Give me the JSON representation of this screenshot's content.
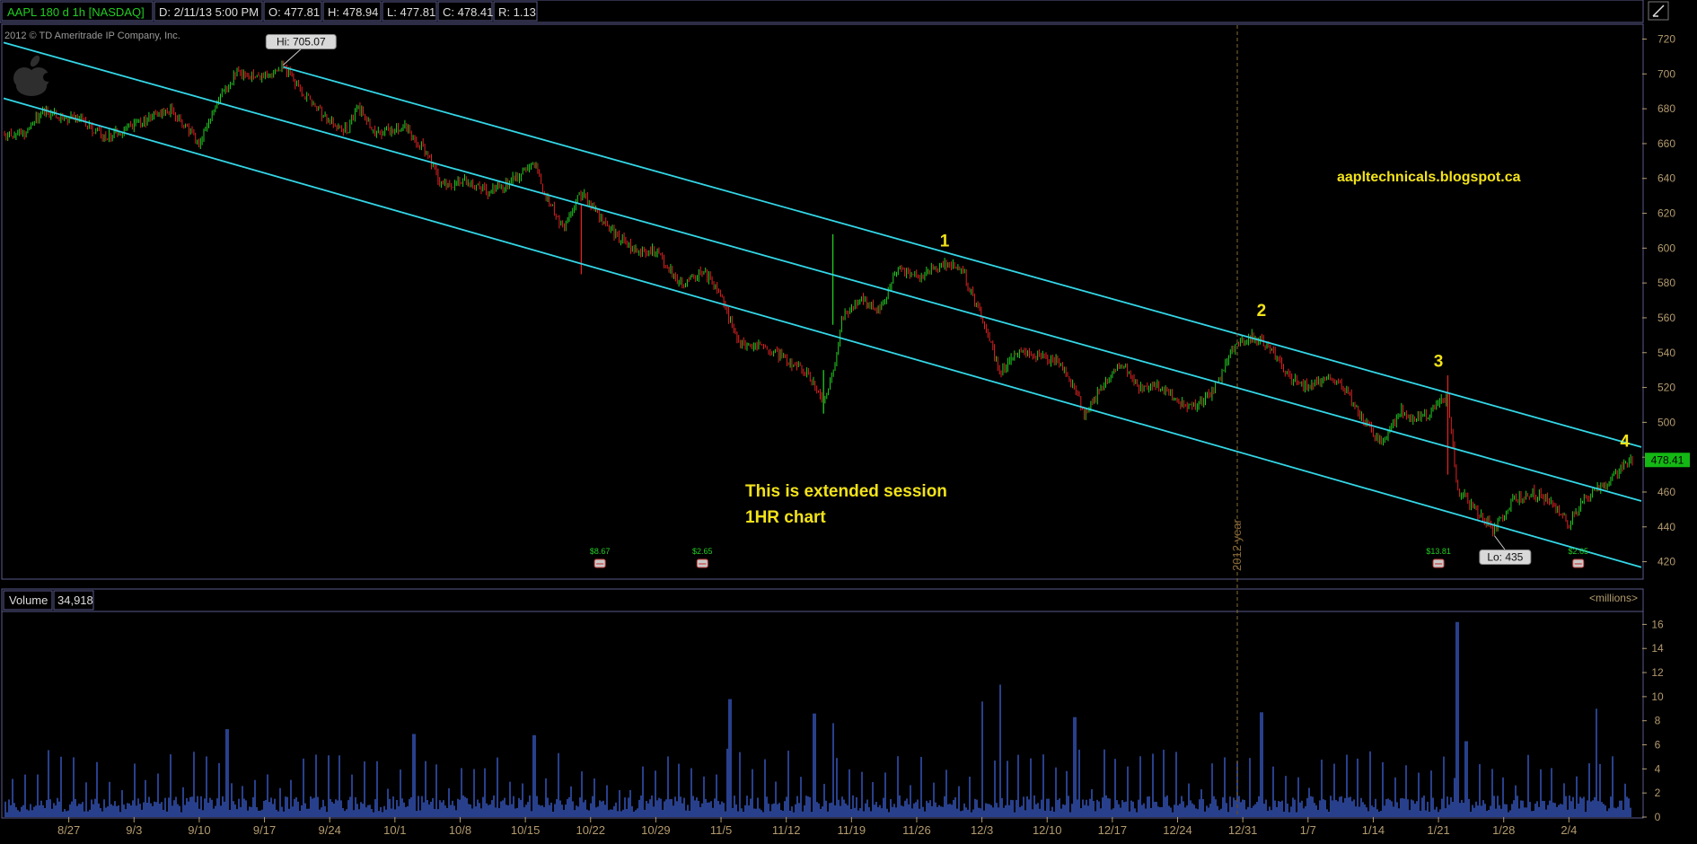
{
  "header": {
    "symbol": "AAPL 180 d 1h [NASDAQ]",
    "date": "D: 2/11/13 5:00 PM",
    "open": "O: 477.81",
    "high": "H: 478.94",
    "low": "L: 477.81",
    "close": "C: 478.41",
    "range": "R: 1.13"
  },
  "copyright": "2012 © TD Ameritrade IP Company, Inc.",
  "watermark_url": "aapltechnicals.blogspot.ca",
  "note_lines": [
    "This is extended session",
    "1HR chart"
  ],
  "year_marker": "2012 year",
  "volume_panel": {
    "label": "Volume",
    "value": "34,918",
    "units": "<millions>"
  },
  "colors": {
    "up": "#22cc22",
    "down": "#dd2222",
    "channel": "#33d6e6",
    "volume": "#3a5cc8",
    "text_yellow": "#f2e21a",
    "axis": "#b39a6e",
    "frame": "#5a5a8c",
    "last_price_bg": "#14b814"
  },
  "chart_data": [
    {
      "type": "candlestick",
      "title": "AAPL 180 d 1h [NASDAQ]",
      "x": [
        "8/27",
        "9/3",
        "9/10",
        "9/17",
        "9/24",
        "10/1",
        "10/8",
        "10/15",
        "10/22",
        "10/29",
        "11/5",
        "11/12",
        "11/19",
        "11/26",
        "12/3",
        "12/10",
        "12/17",
        "12/24",
        "12/31",
        "1/7",
        "1/14",
        "1/21",
        "1/28",
        "2/4"
      ],
      "ylim": [
        410,
        728
      ],
      "y_ticks": [
        420,
        440,
        460,
        480,
        500,
        520,
        540,
        560,
        580,
        600,
        620,
        640,
        660,
        680,
        700,
        720
      ],
      "path_points": [
        {
          "x": "8/22",
          "y": 665
        },
        {
          "x": "8/24",
          "y": 678
        },
        {
          "x": "8/28",
          "y": 674
        },
        {
          "x": "8/31",
          "y": 663
        },
        {
          "x": "9/5",
          "y": 675
        },
        {
          "x": "9/7",
          "y": 680
        },
        {
          "x": "9/10",
          "y": 660
        },
        {
          "x": "9/12",
          "y": 685
        },
        {
          "x": "9/14",
          "y": 700
        },
        {
          "x": "9/17",
          "y": 698
        },
        {
          "x": "9/19",
          "y": 705
        },
        {
          "x": "9/21",
          "y": 690
        },
        {
          "x": "9/24",
          "y": 672
        },
        {
          "x": "9/26",
          "y": 668
        },
        {
          "x": "9/27",
          "y": 682
        },
        {
          "x": "9/29",
          "y": 665
        },
        {
          "x": "10/2",
          "y": 670
        },
        {
          "x": "10/4",
          "y": 658
        },
        {
          "x": "10/6",
          "y": 636
        },
        {
          "x": "10/9",
          "y": 638
        },
        {
          "x": "10/11",
          "y": 632
        },
        {
          "x": "10/14",
          "y": 640
        },
        {
          "x": "10/16",
          "y": 650
        },
        {
          "x": "10/17",
          "y": 632
        },
        {
          "x": "10/19",
          "y": 612
        },
        {
          "x": "10/21",
          "y": 632
        },
        {
          "x": "10/23",
          "y": 618
        },
        {
          "x": "10/25",
          "y": 606
        },
        {
          "x": "10/27",
          "y": 598
        },
        {
          "x": "10/29",
          "y": 598
        },
        {
          "x": "11/1",
          "y": 578
        },
        {
          "x": "11/3",
          "y": 588
        },
        {
          "x": "11/5",
          "y": 572
        },
        {
          "x": "11/7",
          "y": 545
        },
        {
          "x": "11/10",
          "y": 542
        },
        {
          "x": "11/12",
          "y": 536
        },
        {
          "x": "11/14",
          "y": 530
        },
        {
          "x": "11/16",
          "y": 512
        },
        {
          "x": "11/17",
          "y": 528
        },
        {
          "x": "11/18",
          "y": 560
        },
        {
          "x": "11/20",
          "y": 570
        },
        {
          "x": "11/22",
          "y": 565
        },
        {
          "x": "11/24",
          "y": 588
        },
        {
          "x": "11/26",
          "y": 583
        },
        {
          "x": "11/28",
          "y": 588
        },
        {
          "x": "11/29",
          "y": 592
        },
        {
          "x": "12/1",
          "y": 585
        },
        {
          "x": "12/3",
          "y": 560
        },
        {
          "x": "12/5",
          "y": 528
        },
        {
          "x": "12/7",
          "y": 542
        },
        {
          "x": "12/9",
          "y": 538
        },
        {
          "x": "12/11",
          "y": 535
        },
        {
          "x": "12/13",
          "y": 520
        },
        {
          "x": "12/14",
          "y": 503
        },
        {
          "x": "12/16",
          "y": 522
        },
        {
          "x": "12/18",
          "y": 533
        },
        {
          "x": "12/20",
          "y": 520
        },
        {
          "x": "12/22",
          "y": 520
        },
        {
          "x": "12/24",
          "y": 512
        },
        {
          "x": "12/26",
          "y": 508
        },
        {
          "x": "12/28",
          "y": 520
        },
        {
          "x": "12/30",
          "y": 542
        },
        {
          "x": "1/1",
          "y": 550
        },
        {
          "x": "1/3",
          "y": 542
        },
        {
          "x": "1/5",
          "y": 525
        },
        {
          "x": "1/7",
          "y": 520
        },
        {
          "x": "1/9",
          "y": 525
        },
        {
          "x": "1/11",
          "y": 520
        },
        {
          "x": "1/13",
          "y": 500
        },
        {
          "x": "1/15",
          "y": 488
        },
        {
          "x": "1/17",
          "y": 508
        },
        {
          "x": "1/18",
          "y": 502
        },
        {
          "x": "1/20",
          "y": 505
        },
        {
          "x": "1/22",
          "y": 515
        },
        {
          "x": "1/23",
          "y": 462
        },
        {
          "x": "1/25",
          "y": 450
        },
        {
          "x": "1/27",
          "y": 438
        },
        {
          "x": "1/29",
          "y": 455
        },
        {
          "x": "1/31",
          "y": 460
        },
        {
          "x": "2/2",
          "y": 455
        },
        {
          "x": "2/4",
          "y": 442
        },
        {
          "x": "2/6",
          "y": 458
        },
        {
          "x": "2/8",
          "y": 465
        },
        {
          "x": "2/10",
          "y": 476
        },
        {
          "x": "2/11",
          "y": 478.41
        }
      ],
      "channel_lines": [
        {
          "name": "upper",
          "from": {
            "x": "9/19",
            "y": 704
          },
          "to": {
            "x": "2/11",
            "y": 487
          }
        },
        {
          "name": "middle",
          "from": {
            "x": "8/20",
            "y": 718
          },
          "to": {
            "x": "2/11",
            "y": 456
          }
        },
        {
          "name": "lower",
          "from": {
            "x": "8/20",
            "y": 686
          },
          "to": {
            "x": "2/11",
            "y": 418
          }
        }
      ],
      "annotations": [
        {
          "label": "Hi: 705.07",
          "x": "9/19",
          "y": 705.07,
          "box": true
        },
        {
          "label": "Lo: 435",
          "x": "1/27",
          "y": 435,
          "box": true
        },
        {
          "label": "1",
          "x": "11/29",
          "y": 601,
          "box": false
        },
        {
          "label": "2",
          "x": "1/2",
          "y": 561,
          "box": false
        },
        {
          "label": "3",
          "x": "1/21",
          "y": 532,
          "box": false
        },
        {
          "label": "4",
          "x": "2/10",
          "y": 486,
          "box": false
        }
      ],
      "last_price": "478.41",
      "events": [
        {
          "label": "$8.67",
          "x": "10/23"
        },
        {
          "label": "$2.65",
          "x": "11/3"
        },
        {
          "label": "$13.81",
          "x": "1/21"
        },
        {
          "label": "$2.65",
          "x": "2/5"
        }
      ]
    },
    {
      "type": "bar",
      "title": "Volume",
      "units": "<millions>",
      "ylim": [
        0,
        17
      ],
      "y_ticks": [
        0,
        2,
        4,
        6,
        8,
        10,
        12,
        14,
        16
      ],
      "spikes": [
        {
          "x": "9/13",
          "y": 7.3
        },
        {
          "x": "10/3",
          "y": 6.9
        },
        {
          "x": "10/16",
          "y": 6.8
        },
        {
          "x": "11/6",
          "y": 9.8
        },
        {
          "x": "11/15",
          "y": 8.6
        },
        {
          "x": "11/17",
          "y": 7.8
        },
        {
          "x": "12/3",
          "y": 9.6
        },
        {
          "x": "12/5",
          "y": 11
        },
        {
          "x": "12/13",
          "y": 8.3
        },
        {
          "x": "1/2",
          "y": 8.7
        },
        {
          "x": "1/23",
          "y": 16.2
        },
        {
          "x": "1/24",
          "y": 6.3
        },
        {
          "x": "2/7",
          "y": 9.0
        }
      ]
    }
  ]
}
